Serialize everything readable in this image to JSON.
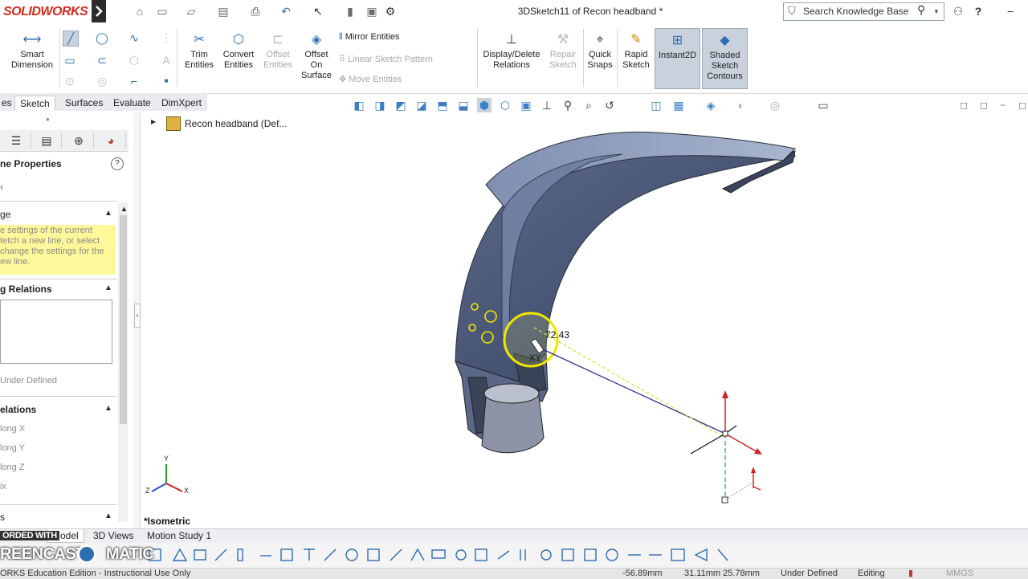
{
  "app": {
    "logo_text": "SOLIDWORKS",
    "document_title": "3DSketch11 of Recon headband *"
  },
  "search": {
    "placeholder": "Search Knowledge Base"
  },
  "ribbon": {
    "smart_dimension": "Smart\nDimension",
    "trim_entities": "Trim\nEntities",
    "convert_entities": "Convert\nEntities",
    "offset_entities": "Offset\nEntities",
    "offset_on_surface": "Offset\nOn\nSurface",
    "mirror_entities": "Mirror Entities",
    "linear_sketch_pattern": "Linear Sketch Pattern",
    "move_entities": "Move Entities",
    "display_delete_relations": "Display/Delete\nRelations",
    "repair_sketch": "Repair\nSketch",
    "quick_snaps": "Quick\nSnaps",
    "rapid_sketch": "Rapid\nSketch",
    "instant2d": "Instant2D",
    "shaded_sketch_contours": "Shaded\nSketch\nContours"
  },
  "tabs": [
    "es",
    "Sketch",
    "Surfaces",
    "Evaluate",
    "DimXpert"
  ],
  "panel": {
    "title": "ne Properties",
    "section1_title": "ge",
    "section1_message": "e settings of the current\ntetch a new line, or select\nchange the settings for the\new line.",
    "section2_title": "g Relations",
    "status": "Under Defined",
    "section3_title": "elations",
    "relations": [
      "long X",
      "long Y",
      "long Z",
      "ix"
    ],
    "section4_title": "s"
  },
  "tree": {
    "root": "Recon headband  (Def..."
  },
  "viewport": {
    "dimension_value": "72.43",
    "cursor_plane": "XY",
    "view_label": "*Isometric",
    "triad_labels": {
      "y": "Y",
      "x": "X",
      "z": "Z"
    }
  },
  "bottom_tabs": [
    "Model",
    "3D Views",
    "Motion Study 1"
  ],
  "watermark": {
    "line1": "ORDED WITH",
    "line2": "REENCAST",
    "line3": "MATIC"
  },
  "statusbar": {
    "edition": "ORKS Education Edition - Instructional Use Only",
    "x": "-56.89mm",
    "yz": "31.11mm 25.78mm",
    "state": "Under Defined",
    "mode": "Editing",
    "units": "MMGS"
  },
  "colors": {
    "accent": "#2f6db3",
    "brand": "#d52b1e",
    "model_dark": "#3f4b67",
    "model_light": "#7d8cad",
    "hint_yellow": "#fff89a"
  }
}
